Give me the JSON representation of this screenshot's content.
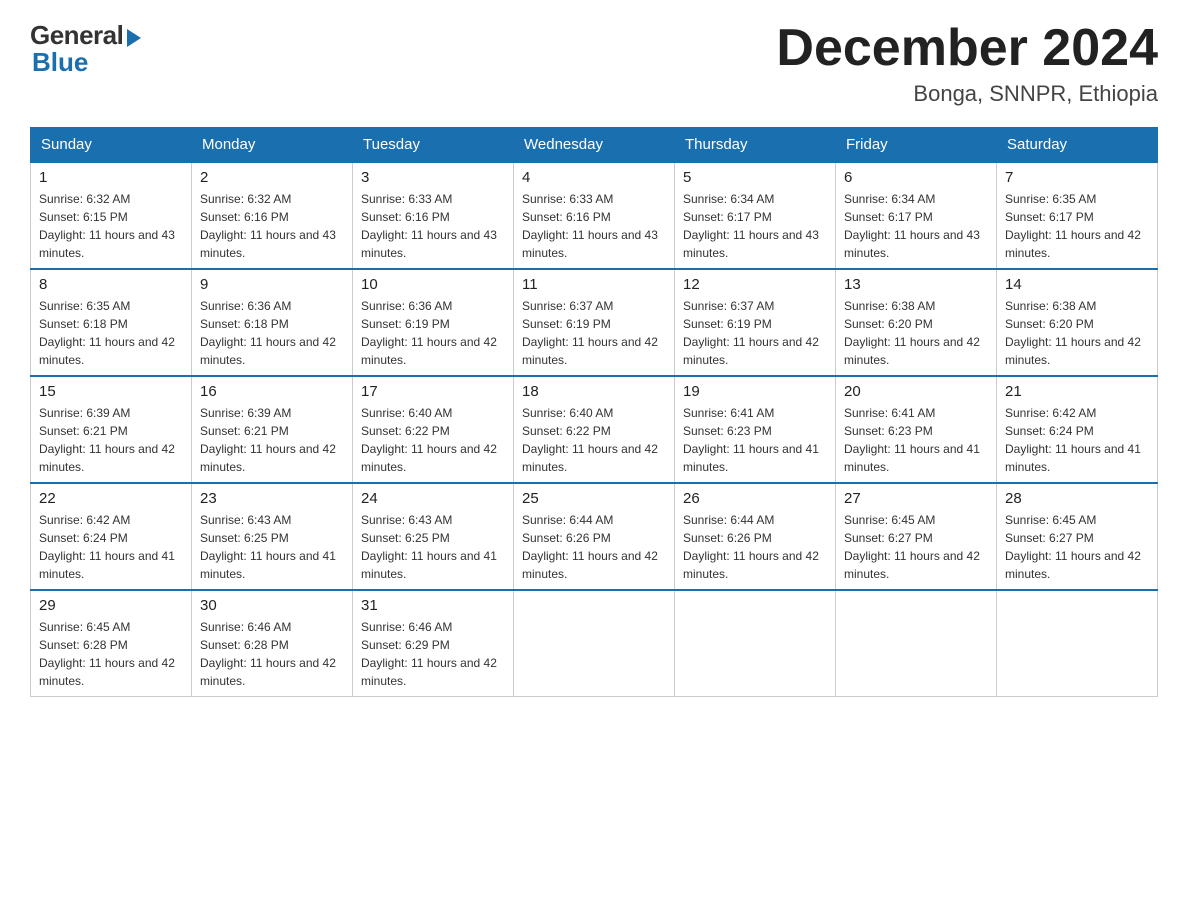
{
  "logo": {
    "general": "General",
    "blue": "Blue"
  },
  "header": {
    "month_year": "December 2024",
    "location": "Bonga, SNNPR, Ethiopia"
  },
  "days_of_week": [
    "Sunday",
    "Monday",
    "Tuesday",
    "Wednesday",
    "Thursday",
    "Friday",
    "Saturday"
  ],
  "weeks": [
    [
      {
        "day": "1",
        "sunrise": "6:32 AM",
        "sunset": "6:15 PM",
        "daylight": "11 hours and 43 minutes."
      },
      {
        "day": "2",
        "sunrise": "6:32 AM",
        "sunset": "6:16 PM",
        "daylight": "11 hours and 43 minutes."
      },
      {
        "day": "3",
        "sunrise": "6:33 AM",
        "sunset": "6:16 PM",
        "daylight": "11 hours and 43 minutes."
      },
      {
        "day": "4",
        "sunrise": "6:33 AM",
        "sunset": "6:16 PM",
        "daylight": "11 hours and 43 minutes."
      },
      {
        "day": "5",
        "sunrise": "6:34 AM",
        "sunset": "6:17 PM",
        "daylight": "11 hours and 43 minutes."
      },
      {
        "day": "6",
        "sunrise": "6:34 AM",
        "sunset": "6:17 PM",
        "daylight": "11 hours and 43 minutes."
      },
      {
        "day": "7",
        "sunrise": "6:35 AM",
        "sunset": "6:17 PM",
        "daylight": "11 hours and 42 minutes."
      }
    ],
    [
      {
        "day": "8",
        "sunrise": "6:35 AM",
        "sunset": "6:18 PM",
        "daylight": "11 hours and 42 minutes."
      },
      {
        "day": "9",
        "sunrise": "6:36 AM",
        "sunset": "6:18 PM",
        "daylight": "11 hours and 42 minutes."
      },
      {
        "day": "10",
        "sunrise": "6:36 AM",
        "sunset": "6:19 PM",
        "daylight": "11 hours and 42 minutes."
      },
      {
        "day": "11",
        "sunrise": "6:37 AM",
        "sunset": "6:19 PM",
        "daylight": "11 hours and 42 minutes."
      },
      {
        "day": "12",
        "sunrise": "6:37 AM",
        "sunset": "6:19 PM",
        "daylight": "11 hours and 42 minutes."
      },
      {
        "day": "13",
        "sunrise": "6:38 AM",
        "sunset": "6:20 PM",
        "daylight": "11 hours and 42 minutes."
      },
      {
        "day": "14",
        "sunrise": "6:38 AM",
        "sunset": "6:20 PM",
        "daylight": "11 hours and 42 minutes."
      }
    ],
    [
      {
        "day": "15",
        "sunrise": "6:39 AM",
        "sunset": "6:21 PM",
        "daylight": "11 hours and 42 minutes."
      },
      {
        "day": "16",
        "sunrise": "6:39 AM",
        "sunset": "6:21 PM",
        "daylight": "11 hours and 42 minutes."
      },
      {
        "day": "17",
        "sunrise": "6:40 AM",
        "sunset": "6:22 PM",
        "daylight": "11 hours and 42 minutes."
      },
      {
        "day": "18",
        "sunrise": "6:40 AM",
        "sunset": "6:22 PM",
        "daylight": "11 hours and 42 minutes."
      },
      {
        "day": "19",
        "sunrise": "6:41 AM",
        "sunset": "6:23 PM",
        "daylight": "11 hours and 41 minutes."
      },
      {
        "day": "20",
        "sunrise": "6:41 AM",
        "sunset": "6:23 PM",
        "daylight": "11 hours and 41 minutes."
      },
      {
        "day": "21",
        "sunrise": "6:42 AM",
        "sunset": "6:24 PM",
        "daylight": "11 hours and 41 minutes."
      }
    ],
    [
      {
        "day": "22",
        "sunrise": "6:42 AM",
        "sunset": "6:24 PM",
        "daylight": "11 hours and 41 minutes."
      },
      {
        "day": "23",
        "sunrise": "6:43 AM",
        "sunset": "6:25 PM",
        "daylight": "11 hours and 41 minutes."
      },
      {
        "day": "24",
        "sunrise": "6:43 AM",
        "sunset": "6:25 PM",
        "daylight": "11 hours and 41 minutes."
      },
      {
        "day": "25",
        "sunrise": "6:44 AM",
        "sunset": "6:26 PM",
        "daylight": "11 hours and 42 minutes."
      },
      {
        "day": "26",
        "sunrise": "6:44 AM",
        "sunset": "6:26 PM",
        "daylight": "11 hours and 42 minutes."
      },
      {
        "day": "27",
        "sunrise": "6:45 AM",
        "sunset": "6:27 PM",
        "daylight": "11 hours and 42 minutes."
      },
      {
        "day": "28",
        "sunrise": "6:45 AM",
        "sunset": "6:27 PM",
        "daylight": "11 hours and 42 minutes."
      }
    ],
    [
      {
        "day": "29",
        "sunrise": "6:45 AM",
        "sunset": "6:28 PM",
        "daylight": "11 hours and 42 minutes."
      },
      {
        "day": "30",
        "sunrise": "6:46 AM",
        "sunset": "6:28 PM",
        "daylight": "11 hours and 42 minutes."
      },
      {
        "day": "31",
        "sunrise": "6:46 AM",
        "sunset": "6:29 PM",
        "daylight": "11 hours and 42 minutes."
      },
      null,
      null,
      null,
      null
    ]
  ],
  "labels": {
    "sunrise": "Sunrise:",
    "sunset": "Sunset:",
    "daylight": "Daylight:"
  },
  "colors": {
    "header_bg": "#1a6faf",
    "header_text": "#ffffff",
    "border": "#1a6faf",
    "cell_border": "#cccccc"
  }
}
